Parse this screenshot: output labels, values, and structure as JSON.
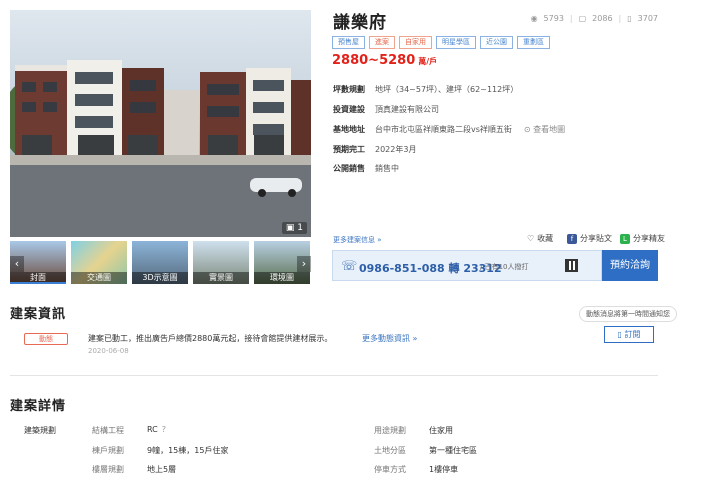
{
  "gallery": {
    "photo_counter": "1",
    "thumbnails": [
      {
        "label": "封面",
        "active": true
      },
      {
        "label": "交通圖",
        "active": false
      },
      {
        "label": "3D示意圖",
        "active": false
      },
      {
        "label": "實景圖",
        "active": false
      },
      {
        "label": "環境圖",
        "active": false
      }
    ]
  },
  "project": {
    "title": "謙樂府",
    "stats": {
      "views": "5793",
      "messages": "2086",
      "calls": "3707"
    },
    "tags": [
      {
        "label": "預售屋",
        "style": "normal"
      },
      {
        "label": "進案",
        "style": "warn"
      },
      {
        "label": "自家用",
        "style": "warn"
      },
      {
        "label": "明星學區",
        "style": "normal"
      },
      {
        "label": "近公園",
        "style": "normal"
      },
      {
        "label": "重劃區",
        "style": "normal"
      }
    ],
    "price": "2880~5280",
    "price_unit": "萬/戶",
    "info": [
      {
        "key": "坪數規劃",
        "value": "地坪（34~57坪）、建坪（62~112坪）"
      },
      {
        "key": "投資建設",
        "value": "頂真建設有限公司"
      },
      {
        "key": "基地地址",
        "value": "台中市北屯區祥順東路二段vs祥順五街",
        "extra": "查看地圖"
      },
      {
        "key": "預期完工",
        "value": "2022年3月"
      },
      {
        "key": "公開銷售",
        "value": "銷售中"
      }
    ],
    "more_info": "更多建案信息 »",
    "actions": {
      "favorite": "收藏",
      "share_fb": "分享貼文",
      "share_line": "分享精友"
    }
  },
  "contact": {
    "phone": "0986-851-088 轉 23312",
    "call_count": "已有10人撥打",
    "reserve_label": "預約洽詢"
  },
  "news_section": {
    "title": "建案資訊",
    "notify_hint": "動態消息將第一時間通知您",
    "subscribe_label": "訂閱",
    "badge": "動態",
    "text": "建案已動工，推出廣告戶總價2880萬元起，接待會館提供建材展示。",
    "date": "2020-06-08",
    "more": "更多動態資訊 »"
  },
  "details_section": {
    "title": "建案詳情",
    "side_label": "建築規劃",
    "specs_left": [
      {
        "key": "結構工程",
        "value": "RC"
      },
      {
        "key": "棟戶規劃",
        "value": "9幢，15棟，15戶住家"
      },
      {
        "key": "樓層規劃",
        "value": "地上5層"
      }
    ],
    "specs_right": [
      {
        "key": "用途規劃",
        "value": "住家用"
      },
      {
        "key": "土地分區",
        "value": "第一種住宅區"
      },
      {
        "key": "停車方式",
        "value": "1樓停車"
      }
    ]
  },
  "colors": {
    "accent": "#2e6fc5",
    "price": "#e2221a",
    "badge": "#e86a55"
  }
}
